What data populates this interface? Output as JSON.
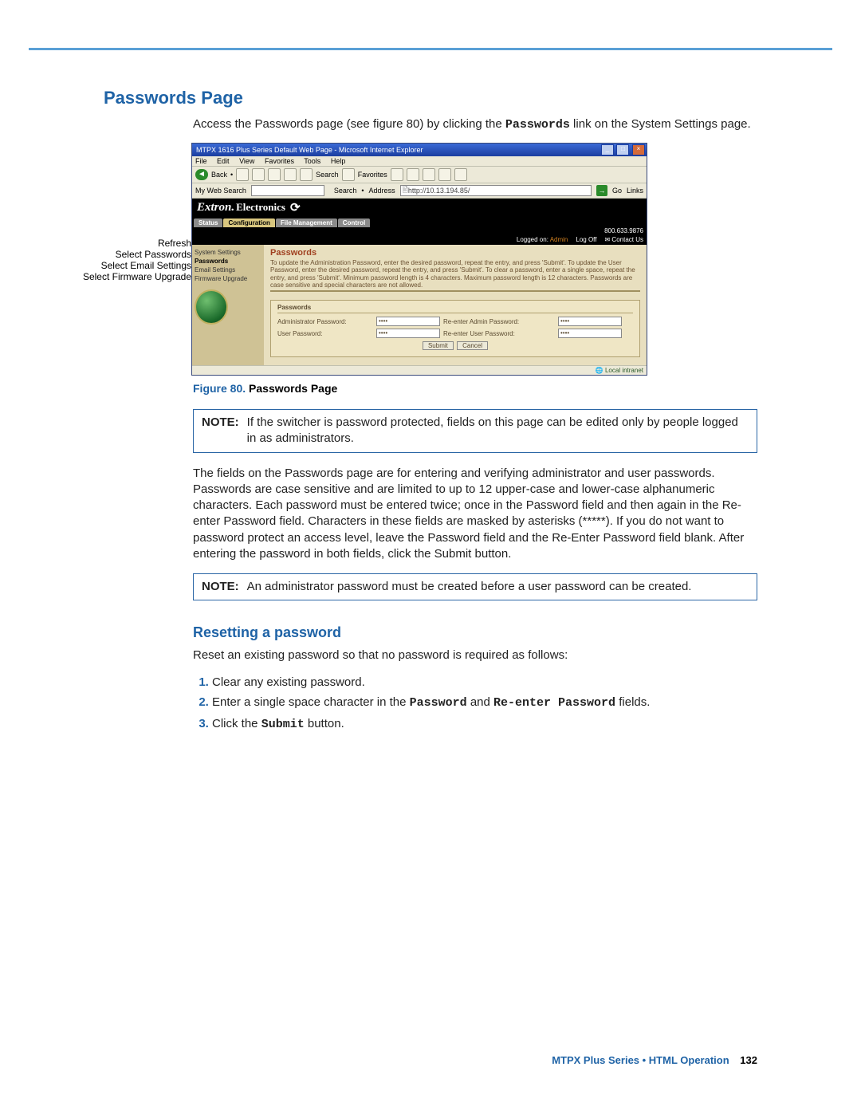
{
  "section": {
    "title": "Passwords Page",
    "intro_a": "Access the Passwords page (see figure 80) by clicking the ",
    "intro_b": "Passwords",
    "intro_c": " link on the System Settings page."
  },
  "callouts": {
    "refresh": "Refresh",
    "passwords": "Select Passwords",
    "email": "Select Email Settings",
    "firmware": "Select Firmware Upgrade"
  },
  "ie": {
    "title": "MTPX 1616 Plus Series Default Web Page - Microsoft Internet Explorer",
    "menubar": [
      "File",
      "Edit",
      "View",
      "Favorites",
      "Tools",
      "Help"
    ],
    "toolbar": {
      "back": "Back",
      "search": "Search",
      "favorites": "Favorites"
    },
    "addrbar": {
      "mysearch": "My Web Search",
      "searchbtn": "Search",
      "addresslabel": "Address",
      "url": "http://10.13.194.85/",
      "go": "Go",
      "links": "Links"
    },
    "banner": {
      "brand": "Extron",
      "sub": " Electronics"
    },
    "tabs": [
      "Status",
      "Configuration",
      "File Management",
      "Control"
    ],
    "subbanner": {
      "logged": "Logged on:",
      "admin": "Admin",
      "logoff": "Log Off",
      "contact": "Contact Us",
      "phone": "800.633.9876"
    },
    "sidemenu": {
      "system": "System Settings",
      "passwords": "Passwords",
      "email": "Email Settings",
      "firmware": "Firmware Upgrade"
    },
    "main": {
      "heading": "Passwords",
      "instructions": "To update the Administration Password, enter the desired password, repeat the entry, and press 'Submit'. To update the User Password, enter the desired password, repeat the entry, and press 'Submit'. To clear a password, enter a single space, repeat the entry, and press 'Submit'. Minimum password length is 4 characters. Maximum password length is 12 characters. Passwords are case sensitive and special characters are not allowed.",
      "box_title": "Passwords",
      "admin_label": "Administrator Password:",
      "admin_re_label": "Re-enter Admin Password:",
      "user_label": "User Password:",
      "user_re_label": "Re-enter User Password:",
      "masked": "••••",
      "submit": "Submit",
      "cancel": "Cancel"
    },
    "statusbar": "Local intranet"
  },
  "figcaption": {
    "label": "Figure 80.",
    "text": " Passwords Page"
  },
  "note1": {
    "label": "NOTE:",
    "text": "If the switcher is password protected, fields on this page can be edited only by people logged in as administrators."
  },
  "bodypara": "The fields on the Passwords page are for entering and verifying administrator and user passwords. Passwords are case sensitive and are limited to up to 12 upper-case and lower-case alphanumeric characters. Each password must be entered twice; once in the Password field and then again in the Re-enter Password field. Characters in these fields are masked by asterisks (*****). If you do not want to password protect an access level, leave the Password field and the Re-Enter Password field blank. After entering the password in both fields, click the Submit button.",
  "note2": {
    "label": "NOTE:",
    "text": "An administrator password must be created before a user password can be created."
  },
  "reset": {
    "title": "Resetting a password",
    "intro": "Reset an existing password so that no password is required as follows:",
    "step1": "Clear any existing password.",
    "step2_a": "Enter a single space character in the ",
    "step2_b": "Password",
    "step2_c": " and ",
    "step2_d": "Re-enter Password",
    "step2_e": " fields.",
    "step3_a": "Click the ",
    "step3_b": "Submit",
    "step3_c": " button."
  },
  "footer": {
    "text": "MTPX Plus Series • HTML Operation",
    "page": "132"
  }
}
